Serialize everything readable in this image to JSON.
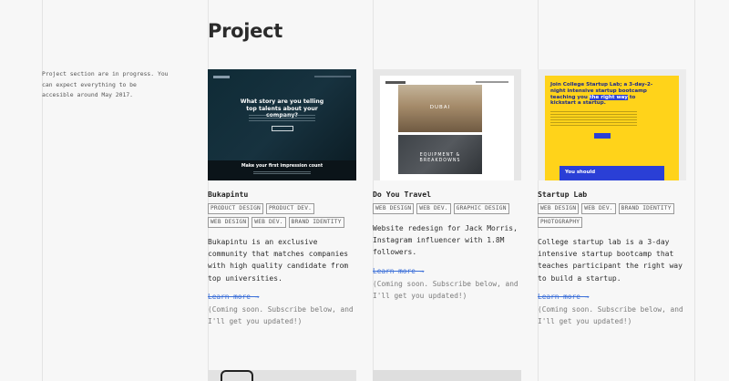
{
  "page": {
    "title": "Project",
    "intro": "Project section are in progress. You can expect everything to be accesible around May 2017."
  },
  "projects": [
    {
      "name": "Bukapintu",
      "tags": [
        "PRODUCT DESIGN",
        "PRODUCT DEV.",
        "WEB DESIGN",
        "WEB DEV.",
        "BRAND IDENTITY"
      ],
      "description": "Bukapintu is an exclusive community that matches companies with high quality candidate from top universities.",
      "learn_more": "Learn more →",
      "note": "(Coming soon. Subscribe below, and I'll get you updated!)",
      "thumb": {
        "headline": "What story are you telling top talents about your company?",
        "subheadline": "Make your first impression count"
      }
    },
    {
      "name": "Do You Travel",
      "tags": [
        "WEB DESIGN",
        "WEB DEV.",
        "GRAPHIC DESIGN"
      ],
      "description": "Website redesign for Jack Morris, Instagram influencer with 1.8M followers.",
      "learn_more": "Learn more →",
      "note": "(Coming soon. Subscribe below, and I'll get you updated!)",
      "thumb": {
        "photo1_text": "DUBAI",
        "photo2_text": "EQUIPMENT & BREAKDOWNS"
      }
    },
    {
      "name": "Startup Lab",
      "tags": [
        "WEB DESIGN",
        "WEB DEV.",
        "BRAND IDENTITY",
        "PHOTOGRAPHY"
      ],
      "description": "College startup lab is a 3-day intensive startup bootcamp that teaches participant the right way to build a startup.",
      "learn_more": "Learn more →",
      "note": "(Coming soon. Subscribe below, and I'll get you updated!)",
      "thumb": {
        "headline_pre": "Join College Startup Lab; a 3-day-2-night intensive startup bootcamp teaching you ",
        "headline_highlight": "the right way",
        "headline_post": " to kickstart a startup.",
        "blue_text": "You should"
      }
    }
  ],
  "colors": {
    "background": "#f7f7f7",
    "link": "#3b6fd8",
    "startup_yellow": "#ffd31a",
    "startup_blue": "#2a3fd6"
  }
}
